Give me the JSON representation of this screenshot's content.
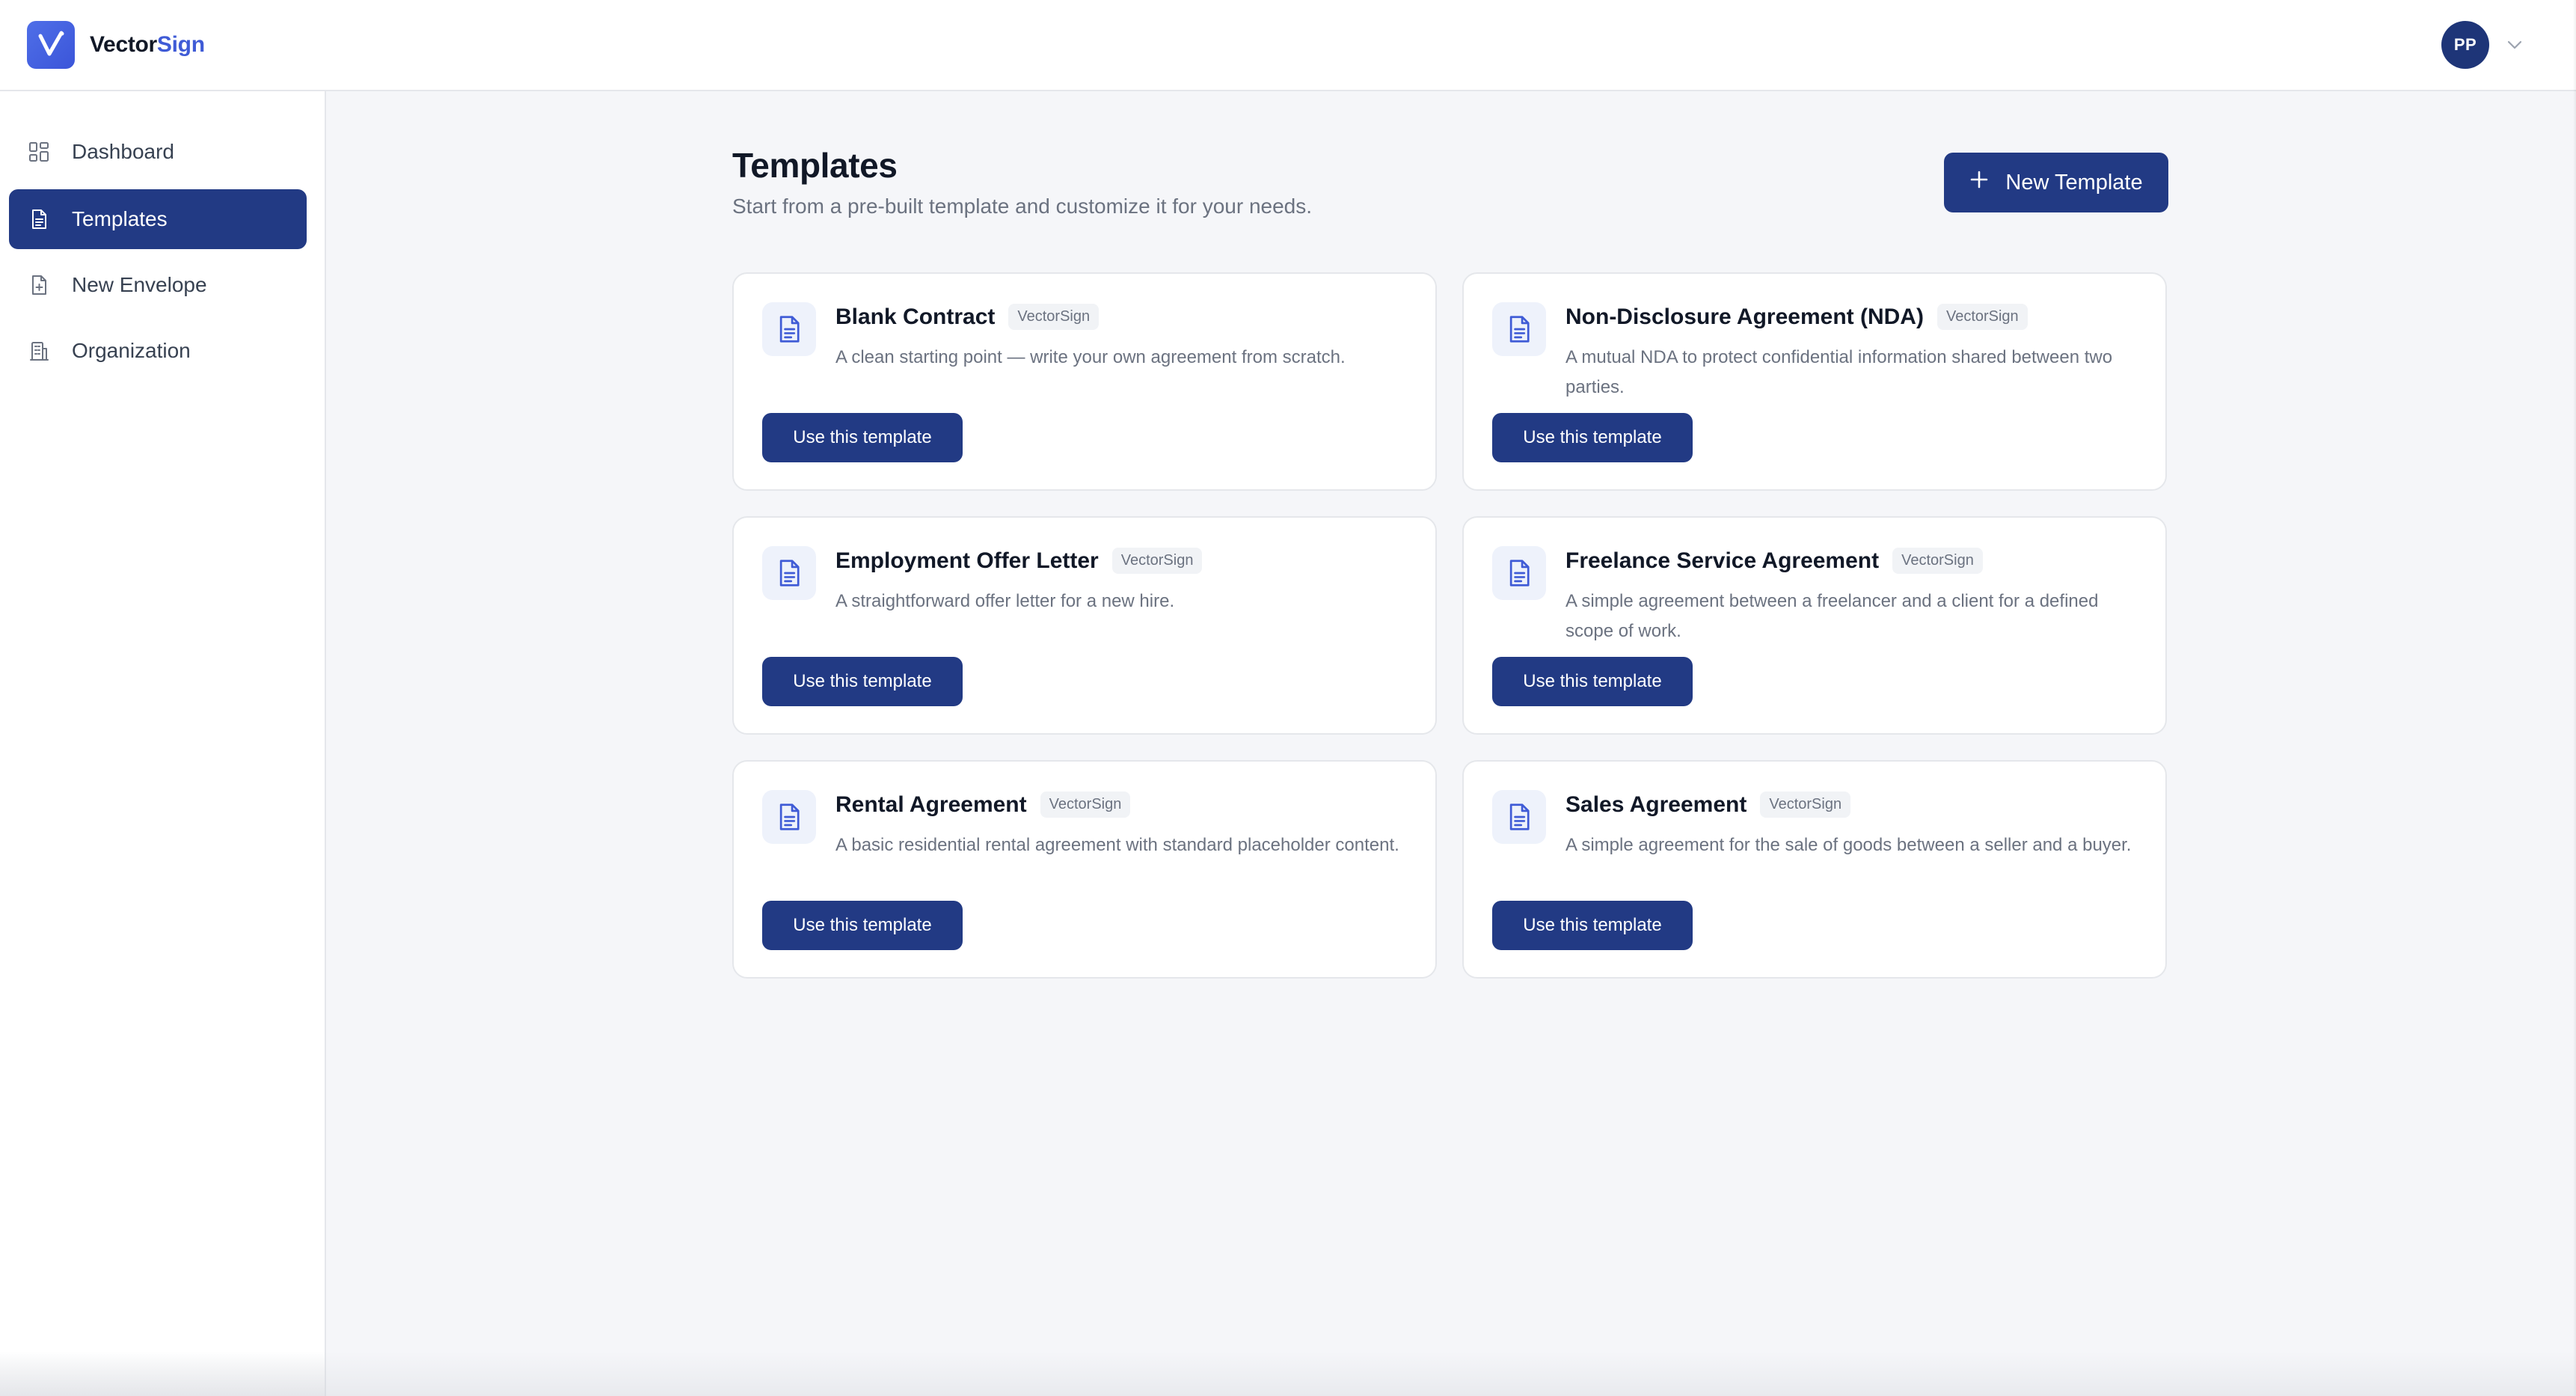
{
  "brand": {
    "name_part1": "Vector",
    "name_part2": "Sign",
    "logo_icon": "checkmark-logo-icon",
    "accent_color": "#3f5bd6"
  },
  "user": {
    "initials": "PP",
    "menu_icon": "chevron-down-icon"
  },
  "sidebar": {
    "items": [
      {
        "label": "Dashboard",
        "icon": "grid-icon",
        "active": false
      },
      {
        "label": "Templates",
        "icon": "document-icon",
        "active": true
      },
      {
        "label": "New Envelope",
        "icon": "file-plus-icon",
        "active": false
      },
      {
        "label": "Organization",
        "icon": "building-icon",
        "active": false
      }
    ]
  },
  "main": {
    "title": "Templates",
    "subtitle": "Start from a pre-built template and customize it for your needs.",
    "new_template_label": "New Template",
    "templates": [
      {
        "title": "Blank Contract",
        "badge": "VectorSign",
        "description": "A clean starting point — write your own agreement from scratch.",
        "button_label": "Use this template"
      },
      {
        "title": "Non-Disclosure Agreement (NDA)",
        "badge": "VectorSign",
        "description": "A mutual NDA to protect confidential information shared between two parties.",
        "button_label": "Use this template"
      },
      {
        "title": "Employment Offer Letter",
        "badge": "VectorSign",
        "description": "A straightforward offer letter for a new hire.",
        "button_label": "Use this template"
      },
      {
        "title": "Freelance Service Agreement",
        "badge": "VectorSign",
        "description": "A simple agreement between a freelancer and a client for a defined scope of work.",
        "button_label": "Use this template"
      },
      {
        "title": "Rental Agreement",
        "badge": "VectorSign",
        "description": "A basic residential rental agreement with standard placeholder content.",
        "button_label": "Use this template"
      },
      {
        "title": "Sales Agreement",
        "badge": "VectorSign",
        "description": "A simple agreement for the sale of goods between a seller and a buyer.",
        "button_label": "Use this template"
      }
    ]
  },
  "colors": {
    "primary": "#223a84",
    "background": "#f5f6f9",
    "text": "#111827",
    "muted": "#6b7280"
  }
}
